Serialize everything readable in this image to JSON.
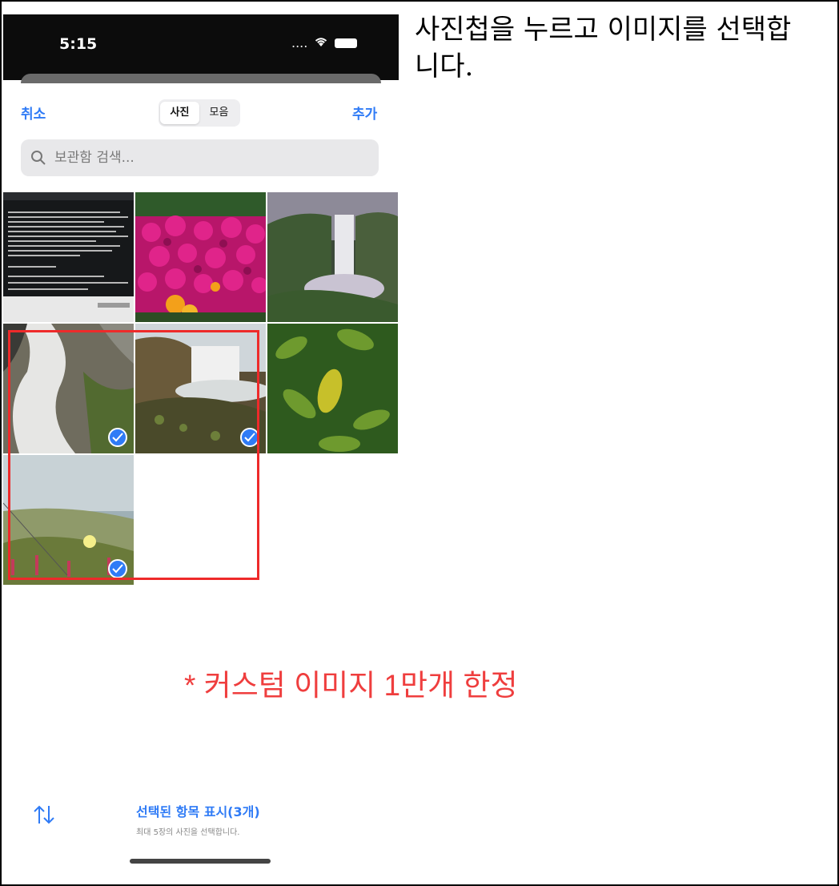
{
  "status_bar": {
    "time": "5:15",
    "signal": "....",
    "icons": [
      "wifi-icon",
      "battery-icon"
    ]
  },
  "picker": {
    "cancel_label": "취소",
    "add_label": "추가",
    "segments": [
      {
        "label": "사진",
        "active": true
      },
      {
        "label": "모음",
        "active": false
      }
    ],
    "search": {
      "placeholder": "보관함 검색..."
    }
  },
  "photos": [
    {
      "subject": "terminal-screenshot",
      "selected": false
    },
    {
      "subject": "magenta-flowers",
      "selected": false
    },
    {
      "subject": "waterfall-cliff",
      "selected": false
    },
    {
      "subject": "waterfall-long-exposure",
      "selected": true
    },
    {
      "subject": "waterfall-rocks",
      "selected": true
    },
    {
      "subject": "green-leaves",
      "selected": false
    },
    {
      "subject": "coastal-plants",
      "selected": true
    }
  ],
  "note": "* 커스텀 이미지 1만개 한정",
  "instruction": "사진첩을 누르고 이미지를 선택합니다.",
  "footer": {
    "selected_title": "선택된 항목 표시(3개)",
    "subtitle": "최대 5장의 사진을 선택합니다."
  },
  "colors": {
    "accent": "#2f7bf6",
    "highlight": "#ee2a2a",
    "note": "#ef3e3e"
  }
}
